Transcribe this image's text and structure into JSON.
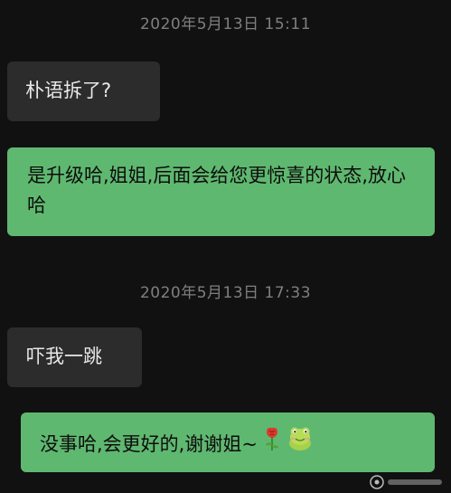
{
  "chat": {
    "timestamps": [
      "2020年5月13日 15:11",
      "2020年5月13日 17:33"
    ],
    "messages": [
      {
        "side": "incoming",
        "text": "朴语拆了?"
      },
      {
        "side": "outgoing",
        "text": "是升级哈,姐姐,后面会给您更惊喜的状态,放心哈"
      },
      {
        "side": "incoming",
        "text": "吓我一跳"
      },
      {
        "side": "outgoing",
        "text": "没事哈,会更好的,谢谢姐~",
        "emojis": [
          "rose-icon",
          "frog-icon"
        ]
      }
    ]
  },
  "colors": {
    "background": "#111111",
    "incoming_bubble": "#2c2c2c",
    "outgoing_bubble": "#5fb870",
    "timestamp_text": "#7f7f7f"
  }
}
